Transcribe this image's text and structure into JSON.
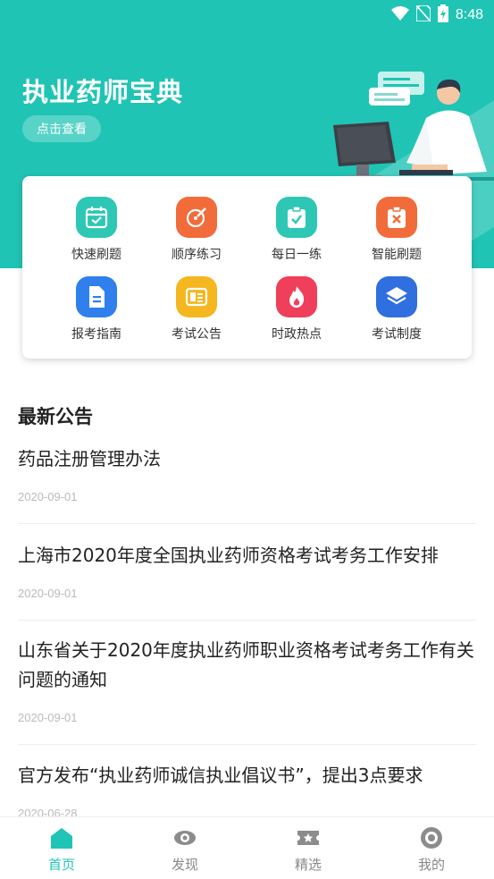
{
  "status_bar": {
    "time": "8:48"
  },
  "header": {
    "title": "执业药师宝典",
    "view_button": "点击查看"
  },
  "features": [
    {
      "label": "快速刷题",
      "icon": "calendar-check-icon",
      "color": "#2ec7b5"
    },
    {
      "label": "顺序练习",
      "icon": "pen-edit-icon",
      "color": "#f26b3a"
    },
    {
      "label": "每日一练",
      "icon": "clipboard-check-icon",
      "color": "#2ec7b5"
    },
    {
      "label": "智能刷题",
      "icon": "clipboard-x-icon",
      "color": "#f26b3a"
    },
    {
      "label": "报考指南",
      "icon": "document-icon",
      "color": "#2f80ed"
    },
    {
      "label": "考试公告",
      "icon": "notice-board-icon",
      "color": "#f5b71f"
    },
    {
      "label": "时政热点",
      "icon": "flame-icon",
      "color": "#ef3f5a"
    },
    {
      "label": "考试制度",
      "icon": "layers-icon",
      "color": "#2f6fe0"
    }
  ],
  "announcements": {
    "title": "最新公告",
    "items": [
      {
        "title": "药品注册管理办法",
        "date": "2020-09-01"
      },
      {
        "title": "上海市2020年度全国执业药师资格考试考务工作安排",
        "date": "2020-09-01"
      },
      {
        "title": "山东省关于2020年度执业药师职业资格考试考务工作有关问题的通知",
        "date": "2020-09-01"
      },
      {
        "title": "官方发布“执业药师诚信执业倡议书”，提出3点要求",
        "date": "2020-06-28"
      }
    ]
  },
  "tabs": [
    {
      "label": "首页",
      "icon": "home-icon",
      "active": true
    },
    {
      "label": "发现",
      "icon": "eye-icon",
      "active": false
    },
    {
      "label": "精选",
      "icon": "ticket-star-icon",
      "active": false
    },
    {
      "label": "我的",
      "icon": "profile-circle-icon",
      "active": false
    }
  ],
  "colors": {
    "accent": "#20c4b4",
    "tab_inactive": "#888888"
  }
}
